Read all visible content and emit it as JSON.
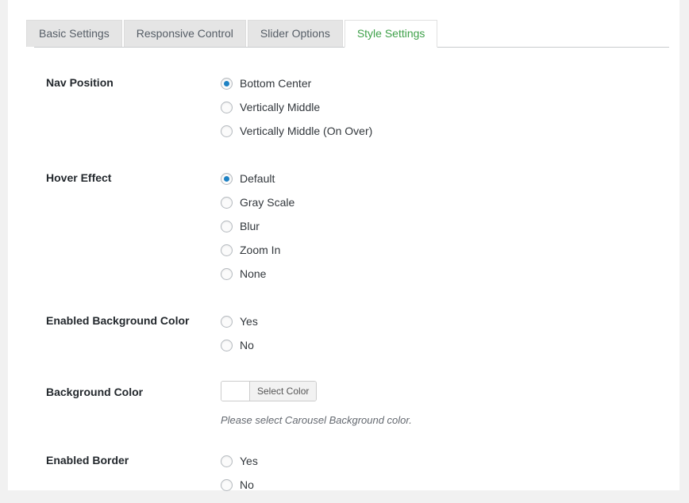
{
  "colors": {
    "page_background": "#f1f1f1",
    "panel_background": "#ffffff",
    "tab_inactive_background": "#e5e5e5",
    "active_tab_text": "#3fa14a",
    "radio_checked_fill": "#1e82c4",
    "label_text": "#23282d",
    "description_text": "#646970"
  },
  "tabs": [
    {
      "label": "Basic Settings",
      "active": false
    },
    {
      "label": "Responsive Control",
      "active": false
    },
    {
      "label": "Slider Options",
      "active": false
    },
    {
      "label": "Style Settings",
      "active": true
    }
  ],
  "settings": {
    "nav_position": {
      "label": "Nav Position",
      "options": [
        {
          "label": "Bottom Center",
          "checked": true
        },
        {
          "label": "Vertically Middle",
          "checked": false
        },
        {
          "label": "Vertically Middle (On Over)",
          "checked": false
        }
      ]
    },
    "hover_effect": {
      "label": "Hover Effect",
      "options": [
        {
          "label": "Default",
          "checked": true
        },
        {
          "label": "Gray Scale",
          "checked": false
        },
        {
          "label": "Blur",
          "checked": false
        },
        {
          "label": "Zoom In",
          "checked": false
        },
        {
          "label": "None",
          "checked": false
        }
      ]
    },
    "enabled_background_color": {
      "label": "Enabled Background Color",
      "options": [
        {
          "label": "Yes",
          "checked": false
        },
        {
          "label": "No",
          "checked": false
        }
      ]
    },
    "background_color": {
      "label": "Background Color",
      "button_label": "Select Color",
      "swatch_value": "#ffffff",
      "description": "Please select Carousel Background color."
    },
    "enabled_border": {
      "label": "Enabled Border",
      "options": [
        {
          "label": "Yes",
          "checked": false
        },
        {
          "label": "No",
          "checked": false
        }
      ]
    }
  }
}
